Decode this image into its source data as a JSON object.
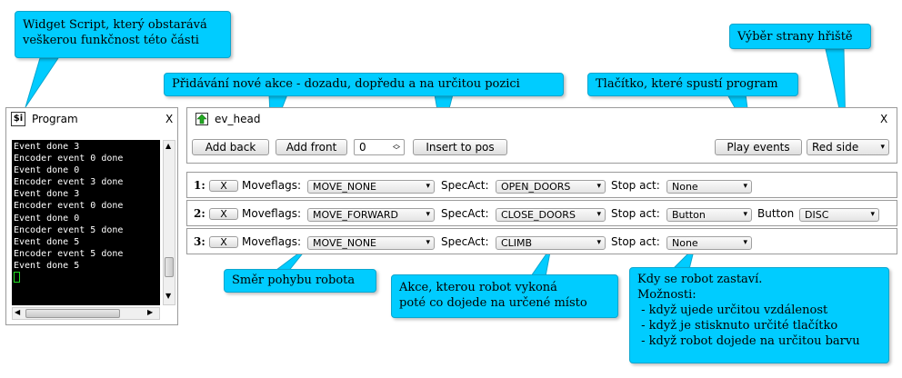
{
  "callouts": {
    "widget_script": {
      "lines": [
        "Widget Script, který obstarává",
        "veškerou funkčnost této části"
      ]
    },
    "add_action": "Přidávání nové akce - dozadu, dopředu a na určitou pozici",
    "play_button": "Tlačítko, které spustí program",
    "side_select": "Výběr strany hřiště",
    "move_direction": "Směr pohybu robota",
    "spec_action": {
      "lines": [
        "Akce, kterou robot vykoná",
        "poté co dojede na určené místo"
      ]
    },
    "stop": {
      "lines": [
        "Kdy se robot zastaví.",
        "Možnosti:",
        " - když ujede určitou vzdálenost",
        " - když je stisknuto určité tlačítko",
        " - když robot dojede na určitou barvu"
      ]
    }
  },
  "program_window": {
    "icon": "$i",
    "title": "Program",
    "close": "X",
    "terminal_lines": [
      "Event done 3",
      "Encoder event 0 done",
      "Event done 0",
      "Encoder event 3 done",
      "Event done 3",
      "Encoder event 0 done",
      "Event done 0",
      "Encoder event 5 done",
      "Event done 5",
      "Encoder event 5 done",
      "Event done 5"
    ]
  },
  "ev_head": {
    "title": "ev_head",
    "close": "X",
    "add_back": "Add back",
    "add_front": "Add front",
    "position_value": "0",
    "insert_to_pos": "Insert to pos",
    "play_events": "Play events",
    "side": "Red side"
  },
  "labels": {
    "remove": "X",
    "moveflags": "Moveflags:",
    "specact": "SpecAct:",
    "stop_act": "Stop act:",
    "button": "Button"
  },
  "events": [
    {
      "num": "1:",
      "moveflags": "MOVE_NONE",
      "specact": "OPEN_DOORS",
      "stop": "None"
    },
    {
      "num": "2:",
      "moveflags": "MOVE_FORWARD",
      "specact": "CLOSE_DOORS",
      "stop": "Button",
      "button_value": "DISC"
    },
    {
      "num": "3:",
      "moveflags": "MOVE_NONE",
      "specact": "CLIMB",
      "stop": "None"
    }
  ]
}
